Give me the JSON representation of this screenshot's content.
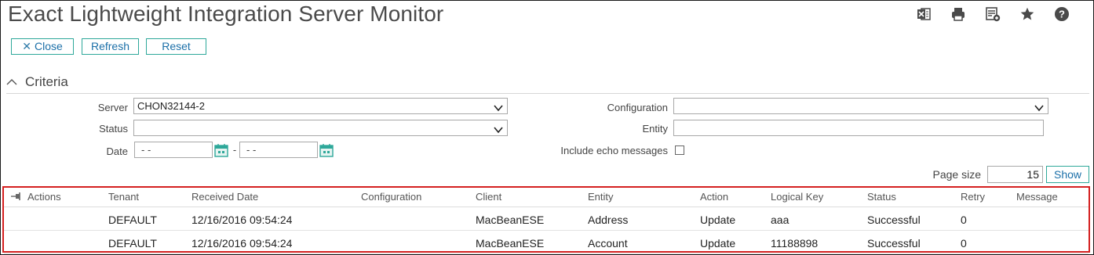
{
  "page": {
    "title": "Exact Lightweight Integration Server Monitor"
  },
  "toolbar_icons": [
    "excel-icon",
    "print-icon",
    "add-to-list-icon",
    "star-icon",
    "help-icon"
  ],
  "buttons": {
    "close": "Close",
    "refresh": "Refresh",
    "reset": "Reset"
  },
  "criteria": {
    "heading": "Criteria",
    "server_label": "Server",
    "server_value": "CHON32144-2",
    "status_label": "Status",
    "status_value": "",
    "date_label": "Date",
    "date_from": "- -",
    "date_sep": "-",
    "date_to": "- -",
    "configuration_label": "Configuration",
    "configuration_value": "",
    "entity_label": "Entity",
    "entity_value": "",
    "echo_label": "Include echo messages",
    "echo_checked": false
  },
  "paging": {
    "label": "Page size",
    "value": "15",
    "show_label": "Show"
  },
  "grid": {
    "columns": [
      "Actions",
      "Tenant",
      "Received Date",
      "Configuration",
      "Client",
      "Entity",
      "Action",
      "Logical Key",
      "Status",
      "Retry",
      "Message"
    ],
    "rows": [
      [
        "",
        "DEFAULT",
        "12/16/2016 09:54:24",
        "",
        "MacBeanESE",
        "Address",
        "Update",
        "aaa",
        "Successful",
        "0",
        ""
      ],
      [
        "",
        "DEFAULT",
        "12/16/2016 09:54:24",
        "",
        "MacBeanESE",
        "Account",
        "Update",
        "11188898",
        "Successful",
        "0",
        ""
      ]
    ]
  },
  "colors": {
    "accent": "#2ea89a",
    "link": "#1b6fa8",
    "highlight_border": "#d42020"
  }
}
